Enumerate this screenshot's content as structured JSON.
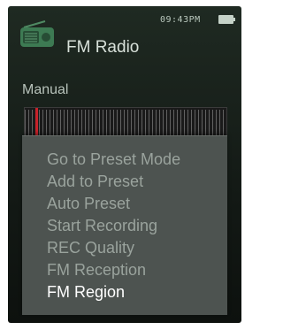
{
  "status_bar": {
    "time": "09:43PM"
  },
  "app": {
    "title": "FM Radio",
    "icon": "radio-icon"
  },
  "mode": {
    "label": "Manual"
  },
  "menu": {
    "items": [
      {
        "label": "Go to Preset Mode",
        "selected": false
      },
      {
        "label": "Add to Preset",
        "selected": false
      },
      {
        "label": "Auto Preset",
        "selected": false
      },
      {
        "label": "Start Recording",
        "selected": false
      },
      {
        "label": "REC Quality",
        "selected": false
      },
      {
        "label": "FM Reception",
        "selected": false
      },
      {
        "label": "FM Region",
        "selected": true
      }
    ]
  },
  "colors": {
    "screen_bg": "#131915",
    "menu_bg": "#4d5350",
    "menu_text": "#9aa39d",
    "menu_selected_text": "#ffffff",
    "tuner_needle": "#c8222a"
  }
}
